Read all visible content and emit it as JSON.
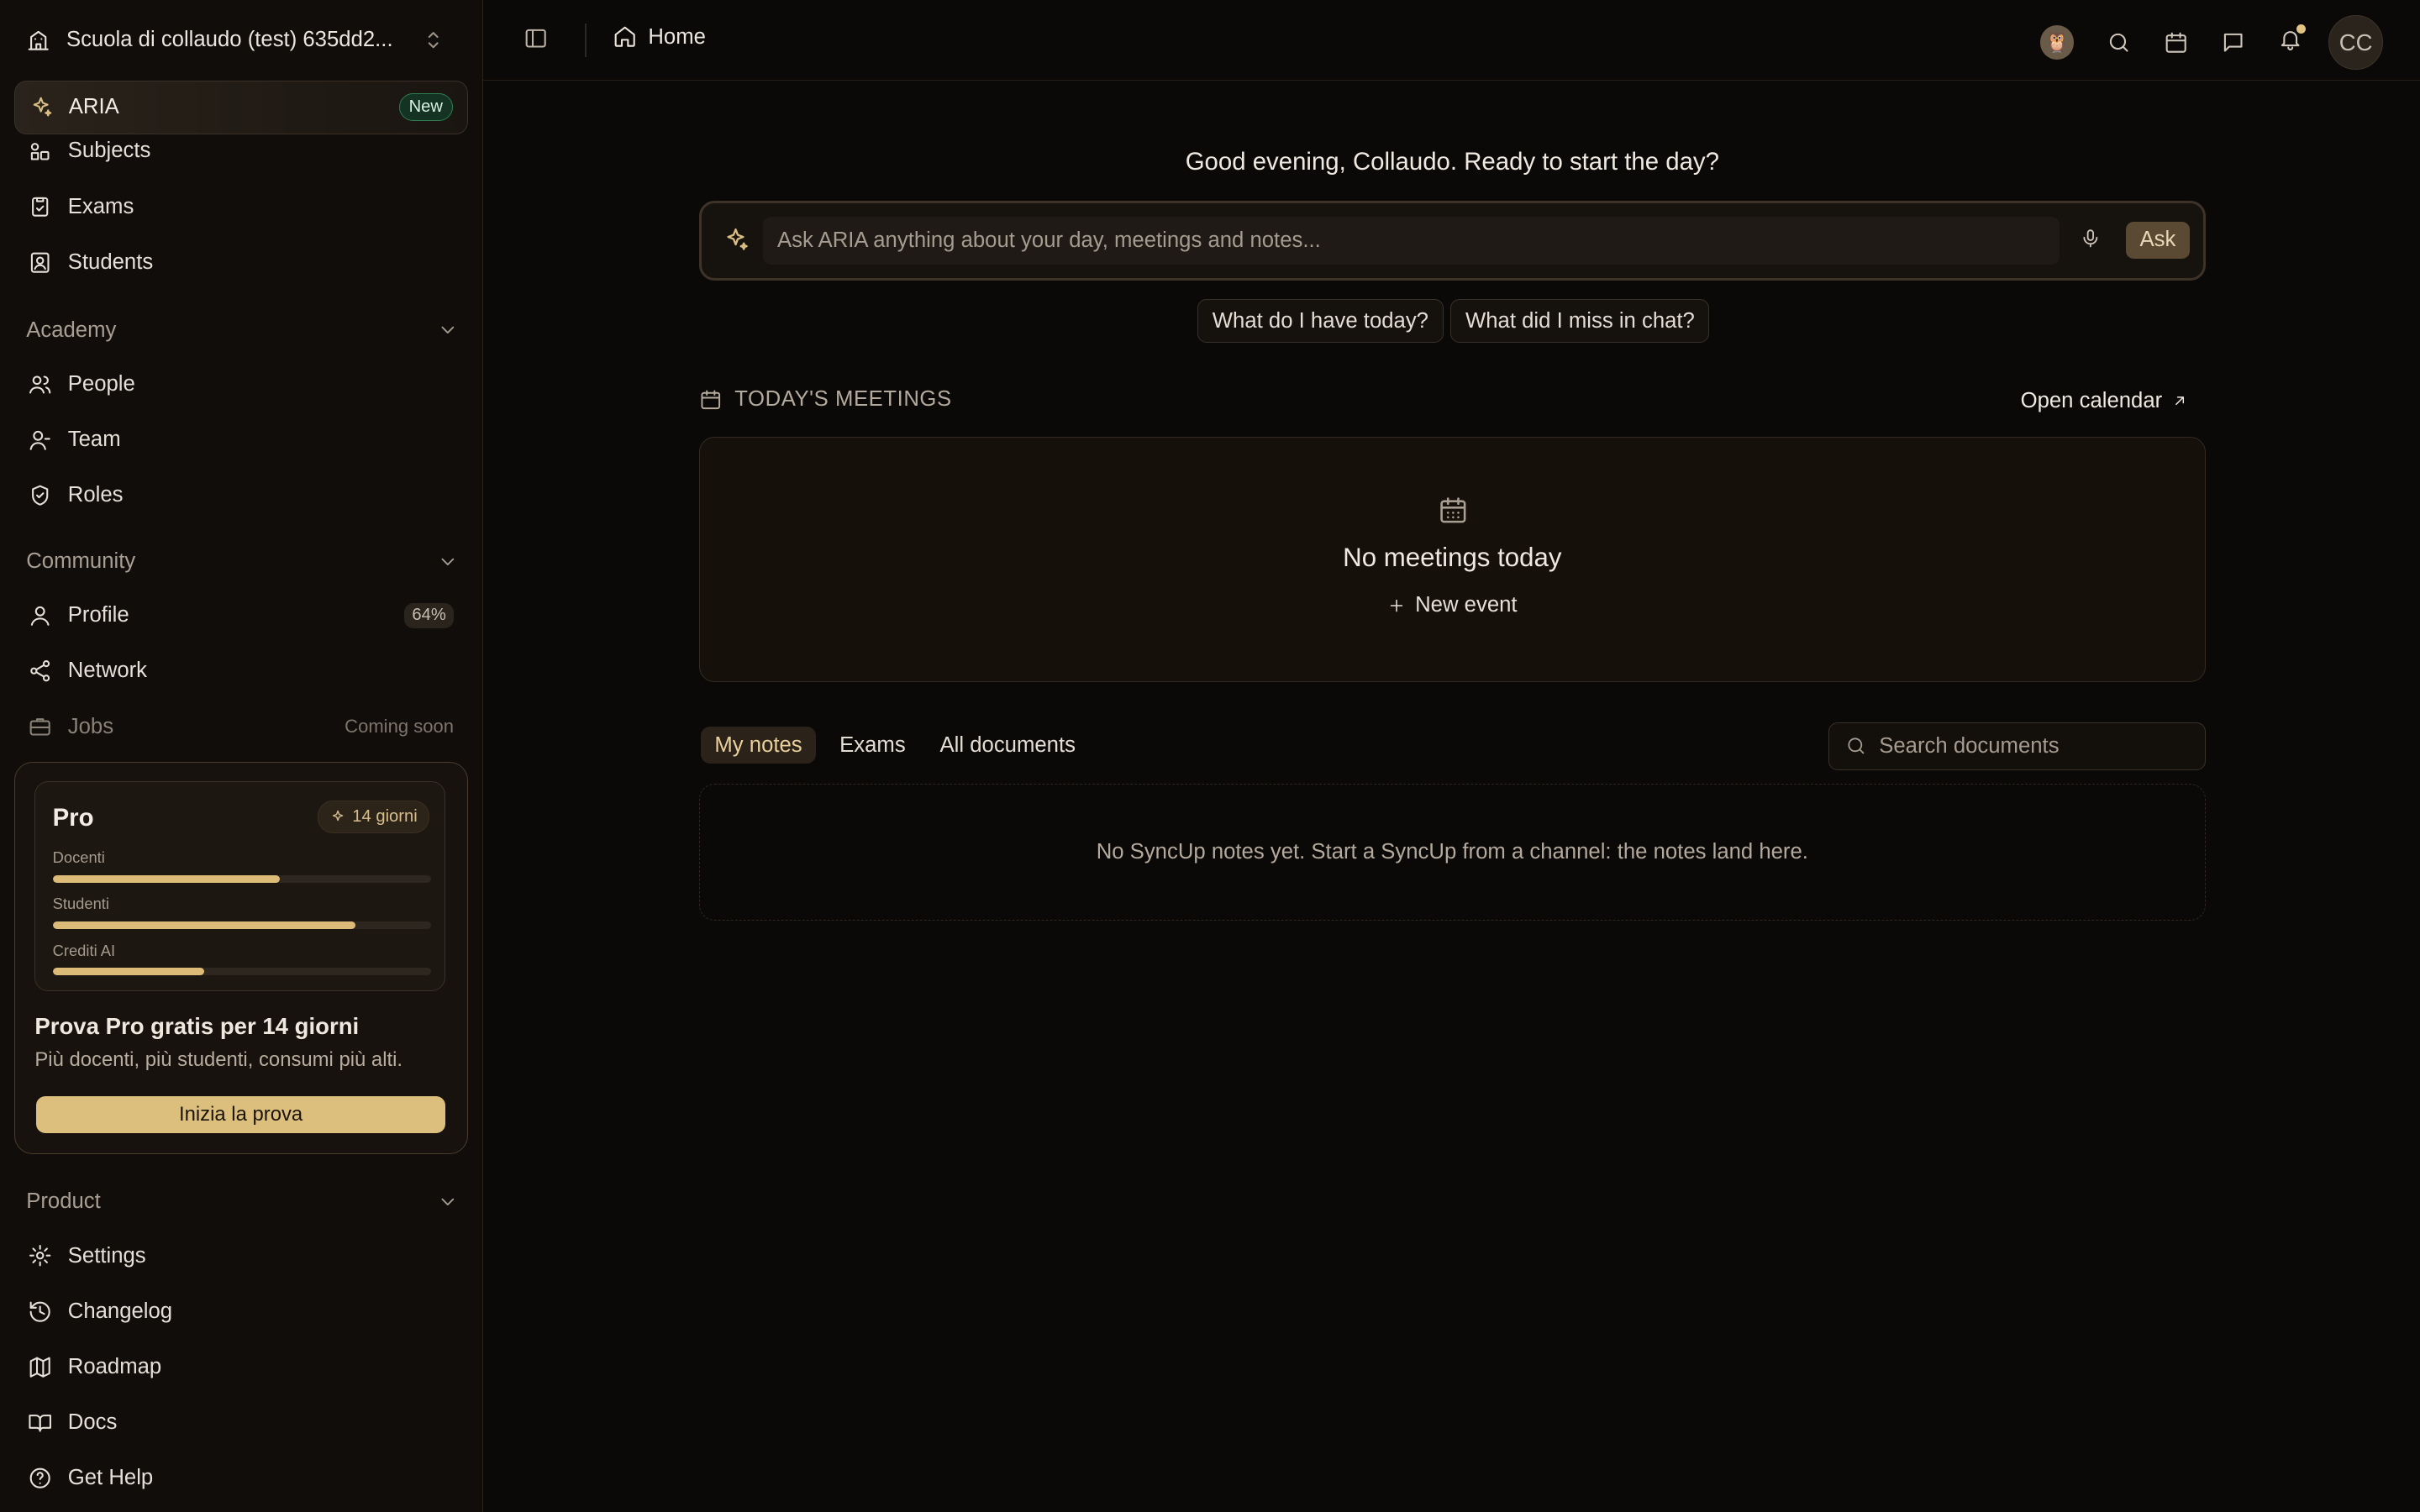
{
  "workspace": {
    "name": "Scuola di collaudo (test) 635dd2..."
  },
  "aria": {
    "label": "ARIA",
    "badge": "New"
  },
  "nav": {
    "subjects": "Subjects",
    "exams": "Exams",
    "students": "Students",
    "academy": {
      "header": "Academy",
      "people": "People",
      "team": "Team",
      "roles": "Roles"
    },
    "community": {
      "header": "Community",
      "profile": "Profile",
      "profile_pct": "64%",
      "network": "Network",
      "jobs": "Jobs",
      "jobs_status": "Coming soon"
    },
    "product": {
      "header": "Product",
      "settings": "Settings",
      "changelog": "Changelog",
      "roadmap": "Roadmap",
      "docs": "Docs",
      "help": "Get Help"
    }
  },
  "promo": {
    "plan": "Pro",
    "badge": "14 giorni",
    "bars": [
      {
        "label": "Docenti",
        "value": 0.6
      },
      {
        "label": "Studenti",
        "value": 0.8
      },
      {
        "label": "Crediti AI",
        "value": 0.4
      }
    ],
    "title": "Prova Pro gratis per 14 giorni",
    "subtitle": "Più docenti, più studenti, consumi più alti.",
    "cta": "Inizia la prova"
  },
  "header": {
    "breadcrumb": "Home",
    "avatar_initials": "CC"
  },
  "main": {
    "greeting": "Good evening, Collaudo. Ready to start the day?",
    "ask_placeholder": "Ask ARIA anything about your day, meetings and notes...",
    "ask_button": "Ask",
    "chips": [
      "What do I have today?",
      "What did I miss in chat?"
    ],
    "meetings": {
      "header": "TODAY'S MEETINGS",
      "open_calendar": "Open calendar",
      "empty": "No meetings today",
      "new_event": "New event"
    },
    "tabs": [
      "My notes",
      "Exams",
      "All documents"
    ],
    "search_placeholder": "Search documents",
    "notes_empty": "No SyncUp notes yet. Start a SyncUp from a channel: the notes land here."
  },
  "colors": {
    "accent": "#ddbf7d",
    "background": "#0b0907",
    "sidebar": "#100d0a",
    "new_badge": "#2e7d4f"
  }
}
